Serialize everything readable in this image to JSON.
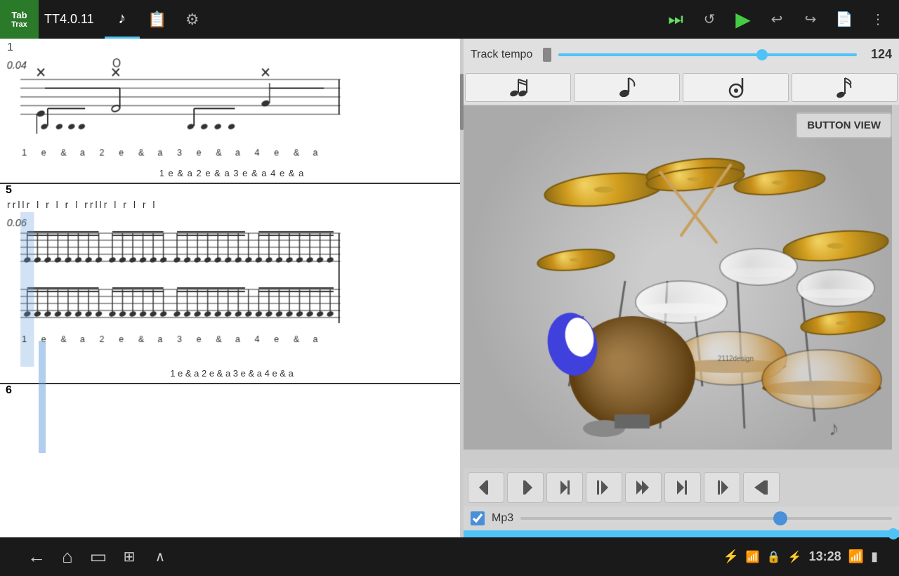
{
  "app": {
    "logo_line1": "Tab",
    "logo_line2": "Trax",
    "version": "TT4.0.11",
    "icon_music": "♪",
    "icon_book": "📖",
    "icon_gear": "⚙"
  },
  "topbar": {
    "play_step": "⏭",
    "replay": "↺",
    "play": "▶",
    "undo": "↩",
    "redo": "↪",
    "save": "🖹",
    "menu": "⋮"
  },
  "tempo": {
    "label": "Track tempo",
    "value": "124"
  },
  "note_types": {
    "btn1": "𝅘𝅥𝅮",
    "btn2": "♩",
    "btn3": "◉",
    "btn4": "𝅘𝅥𝅯"
  },
  "button_view": {
    "label": "BUTTON VIEW"
  },
  "transport": {
    "btn1": "↩",
    "btn2": "↪",
    "btn3": "↵",
    "btn4": "↳",
    "btn5": "⇥",
    "btn6": "→|",
    "btn7": "|→",
    "btn8": "→"
  },
  "mp3": {
    "label": "Mp3",
    "checked": true
  },
  "sheet": {
    "measure1_num": "1",
    "dynamic1": "0.04",
    "beat_row1": "1   e   &   a   2   e   &   a   3   e   &   a   4   e   &   a",
    "section5_num": "5",
    "sticking": "rrllr  l  r  l  r  l  rrllr  l  r  l  r  l",
    "dynamic2": "0.06",
    "beat_row2": "1   e   &   a   2   e   &   a   3   e   &   a   4   e   &   a",
    "section6_num": "6"
  },
  "bottom_nav": {
    "back": "←",
    "home": "⌂",
    "recents": "▭",
    "screenshot": "⊞",
    "up": "∧",
    "time": "13:28",
    "wifi": "WiFi",
    "signal": "▲"
  }
}
